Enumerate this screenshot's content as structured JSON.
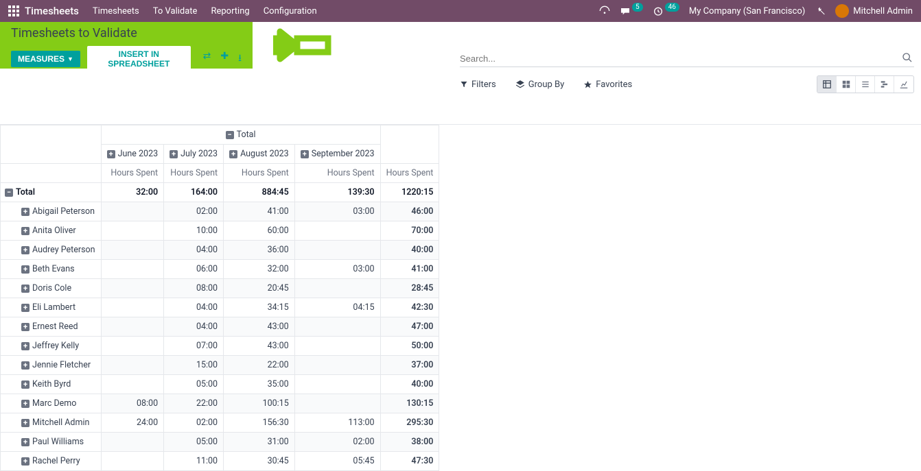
{
  "nav": {
    "brand": "Timesheets",
    "items": [
      "Timesheets",
      "To Validate",
      "Reporting",
      "Configuration"
    ],
    "chat_badge": "5",
    "clock_badge": "46",
    "company": "My Company (San Francisco)",
    "user": "Mitchell Admin"
  },
  "page": {
    "title": "Timesheets to Validate",
    "measures_btn": "MEASURES",
    "insert_btn": "INSERT IN SPREADSHEET",
    "search_placeholder": "Search...",
    "filters": "Filters",
    "groupby": "Group By",
    "favorites": "Favorites"
  },
  "pivot": {
    "total_label": "Total",
    "measure_label": "Hours Spent",
    "columns": [
      "June 2023",
      "July 2023",
      "August 2023",
      "September 2023"
    ],
    "totals": [
      "32:00",
      "164:00",
      "884:45",
      "139:30",
      "1220:15"
    ],
    "rows": [
      {
        "name": "Abigail Peterson",
        "vals": [
          "",
          "02:00",
          "41:00",
          "03:00",
          "46:00"
        ]
      },
      {
        "name": "Anita Oliver",
        "vals": [
          "",
          "10:00",
          "60:00",
          "",
          "70:00"
        ]
      },
      {
        "name": "Audrey Peterson",
        "vals": [
          "",
          "04:00",
          "36:00",
          "",
          "40:00"
        ]
      },
      {
        "name": "Beth Evans",
        "vals": [
          "",
          "06:00",
          "32:00",
          "03:00",
          "41:00"
        ]
      },
      {
        "name": "Doris Cole",
        "vals": [
          "",
          "08:00",
          "20:45",
          "",
          "28:45"
        ]
      },
      {
        "name": "Eli Lambert",
        "vals": [
          "",
          "04:00",
          "34:15",
          "04:15",
          "42:30"
        ]
      },
      {
        "name": "Ernest Reed",
        "vals": [
          "",
          "04:00",
          "43:00",
          "",
          "47:00"
        ]
      },
      {
        "name": "Jeffrey Kelly",
        "vals": [
          "",
          "07:00",
          "43:00",
          "",
          "50:00"
        ]
      },
      {
        "name": "Jennie Fletcher",
        "vals": [
          "",
          "15:00",
          "22:00",
          "",
          "37:00"
        ]
      },
      {
        "name": "Keith Byrd",
        "vals": [
          "",
          "05:00",
          "35:00",
          "",
          "40:00"
        ]
      },
      {
        "name": "Marc Demo",
        "vals": [
          "08:00",
          "22:00",
          "100:15",
          "",
          "130:15"
        ]
      },
      {
        "name": "Mitchell Admin",
        "vals": [
          "24:00",
          "02:00",
          "156:30",
          "113:00",
          "295:30"
        ]
      },
      {
        "name": "Paul Williams",
        "vals": [
          "",
          "05:00",
          "31:00",
          "02:00",
          "38:00"
        ]
      },
      {
        "name": "Rachel Perry",
        "vals": [
          "",
          "11:00",
          "30:45",
          "05:45",
          "47:30"
        ]
      }
    ]
  }
}
